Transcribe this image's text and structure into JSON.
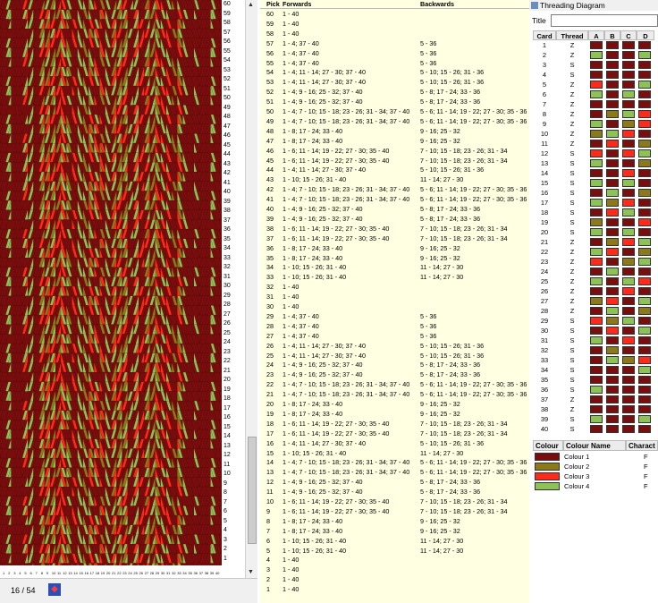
{
  "colors": {
    "c1": "#7a0e0e",
    "c2": "#8c7a1a",
    "c3": "#ff2a1a",
    "c4": "#8dc257"
  },
  "status": {
    "count": "16 / 54",
    "icon": "pattern-icon"
  },
  "columns": {
    "pick": "Pick",
    "forwards": "Forwards",
    "backwards": "Backwards"
  },
  "picks": [
    {
      "n": "60",
      "f": "1 - 40",
      "b": ""
    },
    {
      "n": "59",
      "f": "1 - 40",
      "b": ""
    },
    {
      "n": "58",
      "f": "1 - 40",
      "b": ""
    },
    {
      "n": "57",
      "f": "1 - 4; 37 - 40",
      "b": "5 - 36"
    },
    {
      "n": "56",
      "f": "1 - 4; 37 - 40",
      "b": "5 - 36"
    },
    {
      "n": "55",
      "f": "1 - 4; 37 - 40",
      "b": "5 - 36"
    },
    {
      "n": "54",
      "f": "1 - 4; 11 - 14; 27 - 30; 37 - 40",
      "b": "5 - 10; 15 - 26; 31 - 36"
    },
    {
      "n": "53",
      "f": "1 - 4; 11 - 14; 27 - 30; 37 - 40",
      "b": "5 - 10; 15 - 26; 31 - 36"
    },
    {
      "n": "52",
      "f": "1 - 4; 9 - 16; 25 - 32; 37 - 40",
      "b": "5 - 8; 17 - 24; 33 - 36"
    },
    {
      "n": "51",
      "f": "1 - 4; 9 - 16; 25 - 32; 37 - 40",
      "b": "5 - 8; 17 - 24; 33 - 36"
    },
    {
      "n": "50",
      "f": "1 - 4; 7 - 10; 15 - 18; 23 - 26; 31 - 34; 37 - 40",
      "b": "5 - 6; 11 - 14; 19 - 22; 27 - 30; 35 - 36"
    },
    {
      "n": "49",
      "f": "1 - 4; 7 - 10; 15 - 18; 23 - 26; 31 - 34; 37 - 40",
      "b": "5 - 6; 11 - 14; 19 - 22; 27 - 30; 35 - 36"
    },
    {
      "n": "48",
      "f": "1 - 8; 17 - 24; 33 - 40",
      "b": "9 - 16; 25 - 32"
    },
    {
      "n": "47",
      "f": "1 - 8; 17 - 24; 33 - 40",
      "b": "9 - 16; 25 - 32"
    },
    {
      "n": "46",
      "f": "1 - 6; 11 - 14; 19 - 22; 27 - 30; 35 - 40",
      "b": "7 - 10; 15 - 18; 23 - 26; 31 - 34"
    },
    {
      "n": "45",
      "f": "1 - 6; 11 - 14; 19 - 22; 27 - 30; 35 - 40",
      "b": "7 - 10; 15 - 18; 23 - 26; 31 - 34"
    },
    {
      "n": "44",
      "f": "1 - 4; 11 - 14; 27 - 30; 37 - 40",
      "b": "5 - 10; 15 - 26; 31 - 36"
    },
    {
      "n": "43",
      "f": "1 - 10; 15 - 26; 31 - 40",
      "b": "11 - 14; 27 - 30"
    },
    {
      "n": "42",
      "f": "1 - 4; 7 - 10; 15 - 18; 23 - 26; 31 - 34; 37 - 40",
      "b": "5 - 6; 11 - 14; 19 - 22; 27 - 30; 35 - 36"
    },
    {
      "n": "41",
      "f": "1 - 4; 7 - 10; 15 - 18; 23 - 26; 31 - 34; 37 - 40",
      "b": "5 - 6; 11 - 14; 19 - 22; 27 - 30; 35 - 36"
    },
    {
      "n": "40",
      "f": "1 - 4; 9 - 16; 25 - 32; 37 - 40",
      "b": "5 - 8; 17 - 24; 33 - 36"
    },
    {
      "n": "39",
      "f": "1 - 4; 9 - 16; 25 - 32; 37 - 40",
      "b": "5 - 8; 17 - 24; 33 - 36"
    },
    {
      "n": "38",
      "f": "1 - 6; 11 - 14; 19 - 22; 27 - 30; 35 - 40",
      "b": "7 - 10; 15 - 18; 23 - 26; 31 - 34"
    },
    {
      "n": "37",
      "f": "1 - 6; 11 - 14; 19 - 22; 27 - 30; 35 - 40",
      "b": "7 - 10; 15 - 18; 23 - 26; 31 - 34"
    },
    {
      "n": "36",
      "f": "1 - 8; 17 - 24; 33 - 40",
      "b": "9 - 16; 25 - 32"
    },
    {
      "n": "35",
      "f": "1 - 8; 17 - 24; 33 - 40",
      "b": "9 - 16; 25 - 32"
    },
    {
      "n": "34",
      "f": "1 - 10; 15 - 26; 31 - 40",
      "b": "11 - 14; 27 - 30"
    },
    {
      "n": "33",
      "f": "1 - 10; 15 - 26; 31 - 40",
      "b": "11 - 14; 27 - 30"
    },
    {
      "n": "32",
      "f": "1 - 40",
      "b": ""
    },
    {
      "n": "31",
      "f": "1 - 40",
      "b": ""
    },
    {
      "n": "30",
      "f": "1 - 40",
      "b": ""
    },
    {
      "n": "29",
      "f": "1 - 4; 37 - 40",
      "b": "5 - 36"
    },
    {
      "n": "28",
      "f": "1 - 4; 37 - 40",
      "b": "5 - 36"
    },
    {
      "n": "27",
      "f": "1 - 4; 37 - 40",
      "b": "5 - 36"
    },
    {
      "n": "26",
      "f": "1 - 4; 11 - 14; 27 - 30; 37 - 40",
      "b": "5 - 10; 15 - 26; 31 - 36"
    },
    {
      "n": "25",
      "f": "1 - 4; 11 - 14; 27 - 30; 37 - 40",
      "b": "5 - 10; 15 - 26; 31 - 36"
    },
    {
      "n": "24",
      "f": "1 - 4; 9 - 16; 25 - 32; 37 - 40",
      "b": "5 - 8; 17 - 24; 33 - 36"
    },
    {
      "n": "23",
      "f": "1 - 4; 9 - 16; 25 - 32; 37 - 40",
      "b": "5 - 8; 17 - 24; 33 - 36"
    },
    {
      "n": "22",
      "f": "1 - 4; 7 - 10; 15 - 18; 23 - 26; 31 - 34; 37 - 40",
      "b": "5 - 6; 11 - 14; 19 - 22; 27 - 30; 35 - 36"
    },
    {
      "n": "21",
      "f": "1 - 4; 7 - 10; 15 - 18; 23 - 26; 31 - 34; 37 - 40",
      "b": "5 - 6; 11 - 14; 19 - 22; 27 - 30; 35 - 36"
    },
    {
      "n": "20",
      "f": "1 - 8; 17 - 24; 33 - 40",
      "b": "9 - 16; 25 - 32"
    },
    {
      "n": "19",
      "f": "1 - 8; 17 - 24; 33 - 40",
      "b": "9 - 16; 25 - 32"
    },
    {
      "n": "18",
      "f": "1 - 6; 11 - 14; 19 - 22; 27 - 30; 35 - 40",
      "b": "7 - 10; 15 - 18; 23 - 26; 31 - 34"
    },
    {
      "n": "17",
      "f": "1 - 6; 11 - 14; 19 - 22; 27 - 30; 35 - 40",
      "b": "7 - 10; 15 - 18; 23 - 26; 31 - 34"
    },
    {
      "n": "16",
      "f": "1 - 4; 11 - 14; 27 - 30; 37 - 40",
      "b": "5 - 10; 15 - 26; 31 - 36"
    },
    {
      "n": "15",
      "f": "1 - 10; 15 - 26; 31 - 40",
      "b": "11 - 14; 27 - 30"
    },
    {
      "n": "14",
      "f": "1 - 4; 7 - 10; 15 - 18; 23 - 26; 31 - 34; 37 - 40",
      "b": "5 - 6; 11 - 14; 19 - 22; 27 - 30; 35 - 36"
    },
    {
      "n": "13",
      "f": "1 - 4; 7 - 10; 15 - 18; 23 - 26; 31 - 34; 37 - 40",
      "b": "5 - 6; 11 - 14; 19 - 22; 27 - 30; 35 - 36"
    },
    {
      "n": "12",
      "f": "1 - 4; 9 - 16; 25 - 32; 37 - 40",
      "b": "5 - 8; 17 - 24; 33 - 36"
    },
    {
      "n": "11",
      "f": "1 - 4; 9 - 16; 25 - 32; 37 - 40",
      "b": "5 - 8; 17 - 24; 33 - 36"
    },
    {
      "n": "10",
      "f": "1 - 6; 11 - 14; 19 - 22; 27 - 30; 35 - 40",
      "b": "7 - 10; 15 - 18; 23 - 26; 31 - 34"
    },
    {
      "n": "9",
      "f": "1 - 6; 11 - 14; 19 - 22; 27 - 30; 35 - 40",
      "b": "7 - 10; 15 - 18; 23 - 26; 31 - 34"
    },
    {
      "n": "8",
      "f": "1 - 8; 17 - 24; 33 - 40",
      "b": "9 - 16; 25 - 32"
    },
    {
      "n": "7",
      "f": "1 - 8; 17 - 24; 33 - 40",
      "b": "9 - 16; 25 - 32"
    },
    {
      "n": "6",
      "f": "1 - 10; 15 - 26; 31 - 40",
      "b": "11 - 14; 27 - 30"
    },
    {
      "n": "5",
      "f": "1 - 10; 15 - 26; 31 - 40",
      "b": "11 - 14; 27 - 30"
    },
    {
      "n": "4",
      "f": "1 - 40",
      "b": ""
    },
    {
      "n": "3",
      "f": "1 - 40",
      "b": ""
    },
    {
      "n": "2",
      "f": "1 - 40",
      "b": ""
    },
    {
      "n": "1",
      "f": "1 - 40",
      "b": ""
    }
  ],
  "threading": {
    "window_title": "Threading Diagram",
    "title_label": "Title",
    "title_value": "",
    "headers": [
      "Card",
      "Thread",
      "A",
      "B",
      "C",
      "D"
    ],
    "cards": [
      {
        "n": "1",
        "t": "Z",
        "h": [
          1,
          1,
          1,
          1
        ]
      },
      {
        "n": "2",
        "t": "Z",
        "h": [
          4,
          1,
          1,
          4
        ]
      },
      {
        "n": "3",
        "t": "S",
        "h": [
          1,
          1,
          1,
          1
        ]
      },
      {
        "n": "4",
        "t": "S",
        "h": [
          1,
          1,
          1,
          1
        ]
      },
      {
        "n": "5",
        "t": "Z",
        "h": [
          3,
          1,
          1,
          4
        ]
      },
      {
        "n": "6",
        "t": "Z",
        "h": [
          4,
          1,
          4,
          1
        ]
      },
      {
        "n": "7",
        "t": "Z",
        "h": [
          1,
          1,
          1,
          1
        ]
      },
      {
        "n": "8",
        "t": "Z",
        "h": [
          1,
          2,
          4,
          3
        ]
      },
      {
        "n": "9",
        "t": "Z",
        "h": [
          4,
          1,
          2,
          3
        ]
      },
      {
        "n": "10",
        "t": "Z",
        "h": [
          2,
          4,
          3,
          1
        ]
      },
      {
        "n": "11",
        "t": "Z",
        "h": [
          1,
          3,
          1,
          2
        ]
      },
      {
        "n": "12",
        "t": "S",
        "h": [
          3,
          1,
          3,
          4
        ]
      },
      {
        "n": "13",
        "t": "S",
        "h": [
          4,
          1,
          1,
          2
        ]
      },
      {
        "n": "14",
        "t": "S",
        "h": [
          1,
          1,
          3,
          1
        ]
      },
      {
        "n": "15",
        "t": "S",
        "h": [
          4,
          1,
          4,
          1
        ]
      },
      {
        "n": "16",
        "t": "S",
        "h": [
          1,
          4,
          1,
          2
        ]
      },
      {
        "n": "17",
        "t": "S",
        "h": [
          4,
          2,
          3,
          1
        ]
      },
      {
        "n": "18",
        "t": "S",
        "h": [
          1,
          3,
          4,
          1
        ]
      },
      {
        "n": "19",
        "t": "S",
        "h": [
          2,
          1,
          1,
          3
        ]
      },
      {
        "n": "20",
        "t": "S",
        "h": [
          4,
          1,
          4,
          1
        ]
      },
      {
        "n": "21",
        "t": "Z",
        "h": [
          1,
          2,
          3,
          4
        ]
      },
      {
        "n": "22",
        "t": "Z",
        "h": [
          4,
          3,
          1,
          2
        ]
      },
      {
        "n": "23",
        "t": "Z",
        "h": [
          3,
          1,
          2,
          4
        ]
      },
      {
        "n": "24",
        "t": "Z",
        "h": [
          1,
          4,
          1,
          1
        ]
      },
      {
        "n": "25",
        "t": "Z",
        "h": [
          4,
          1,
          4,
          3
        ]
      },
      {
        "n": "26",
        "t": "Z",
        "h": [
          1,
          1,
          3,
          1
        ]
      },
      {
        "n": "27",
        "t": "Z",
        "h": [
          2,
          3,
          1,
          4
        ]
      },
      {
        "n": "28",
        "t": "Z",
        "h": [
          1,
          4,
          1,
          2
        ]
      },
      {
        "n": "29",
        "t": "S",
        "h": [
          3,
          2,
          4,
          1
        ]
      },
      {
        "n": "30",
        "t": "S",
        "h": [
          1,
          3,
          1,
          4
        ]
      },
      {
        "n": "31",
        "t": "S",
        "h": [
          4,
          1,
          3,
          1
        ]
      },
      {
        "n": "32",
        "t": "S",
        "h": [
          1,
          2,
          1,
          1
        ]
      },
      {
        "n": "33",
        "t": "S",
        "h": [
          1,
          4,
          2,
          3
        ]
      },
      {
        "n": "34",
        "t": "S",
        "h": [
          1,
          1,
          1,
          4
        ]
      },
      {
        "n": "35",
        "t": "S",
        "h": [
          1,
          1,
          1,
          1
        ]
      },
      {
        "n": "36",
        "t": "S",
        "h": [
          4,
          1,
          1,
          1
        ]
      },
      {
        "n": "37",
        "t": "Z",
        "h": [
          1,
          1,
          1,
          1
        ]
      },
      {
        "n": "38",
        "t": "Z",
        "h": [
          1,
          1,
          1,
          1
        ]
      },
      {
        "n": "39",
        "t": "S",
        "h": [
          4,
          1,
          1,
          4
        ]
      },
      {
        "n": "40",
        "t": "S",
        "h": [
          1,
          1,
          1,
          1
        ]
      }
    ]
  },
  "colour_table": {
    "headers": [
      "Colour",
      "Colour Name",
      "Charact"
    ],
    "rows": [
      {
        "name": "Colour 1",
        "char": "F",
        "c": 1
      },
      {
        "name": "Colour 2",
        "char": "F",
        "c": 2
      },
      {
        "name": "Colour 3",
        "char": "F",
        "c": 3
      },
      {
        "name": "Colour 4",
        "char": "F",
        "c": 4
      }
    ]
  }
}
